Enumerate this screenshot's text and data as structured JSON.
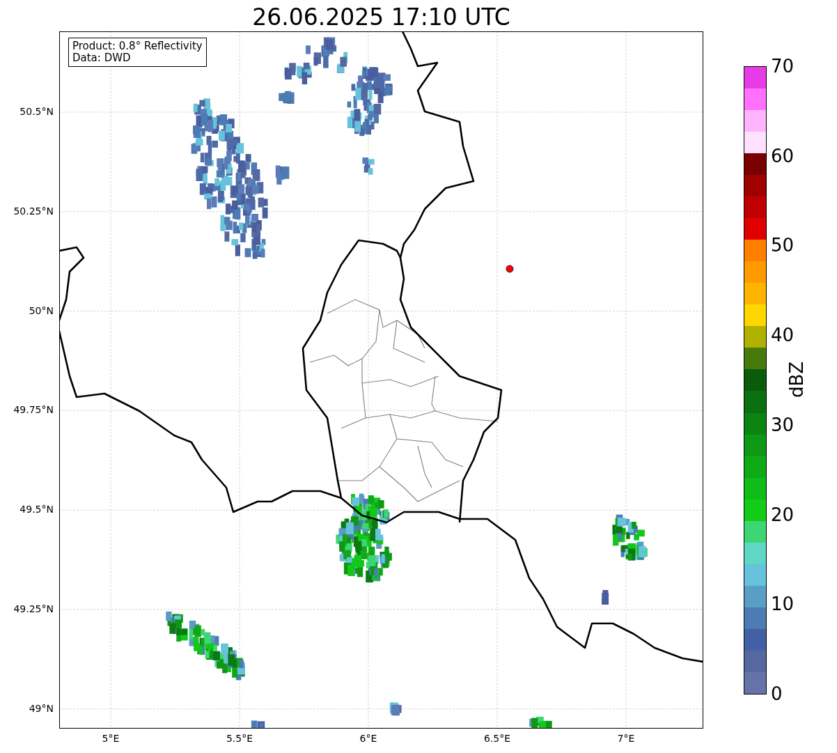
{
  "title": "26.06.2025 17:10 UTC",
  "info_box": {
    "lines": [
      "Product: 0.8° Reflectivity",
      "Data: DWD"
    ]
  },
  "map": {
    "y_ticks": [
      "50.5°N",
      "50.25°N",
      "50°N",
      "49.75°N",
      "49.5°N",
      "49.25°N",
      "49°N"
    ],
    "x_ticks": [
      "5°E",
      "5.5°E",
      "6°E",
      "6.5°E",
      "7°E"
    ]
  },
  "colorbar": {
    "label": "dBZ",
    "ticks": [
      "70",
      "60",
      "50",
      "40",
      "30",
      "20",
      "10",
      "0"
    ],
    "bins": [
      {
        "color": "#e83be8"
      },
      {
        "color": "#ff70ff"
      },
      {
        "color": "#ffb4ff"
      },
      {
        "color": "#ffe0ff"
      },
      {
        "color": "#780000"
      },
      {
        "color": "#a00000"
      },
      {
        "color": "#c00000"
      },
      {
        "color": "#e00000"
      },
      {
        "color": "#ff7f00"
      },
      {
        "color": "#ff9a00"
      },
      {
        "color": "#ffb400"
      },
      {
        "color": "#ffd700"
      },
      {
        "color": "#b0b000"
      },
      {
        "color": "#467a0a"
      },
      {
        "color": "#0a5c0c"
      },
      {
        "color": "#0a7010"
      },
      {
        "color": "#0c8412"
      },
      {
        "color": "#0e9814"
      },
      {
        "color": "#10aa16"
      },
      {
        "color": "#10bc18"
      },
      {
        "color": "#12cc18"
      },
      {
        "color": "#3dd672"
      },
      {
        "color": "#60d6c5"
      },
      {
        "color": "#66c3db"
      },
      {
        "color": "#5a9ec6"
      },
      {
        "color": "#4d7bb4"
      },
      {
        "color": "#4460a4"
      },
      {
        "color": "#5568a0"
      },
      {
        "color": "#6474a8"
      }
    ]
  }
}
